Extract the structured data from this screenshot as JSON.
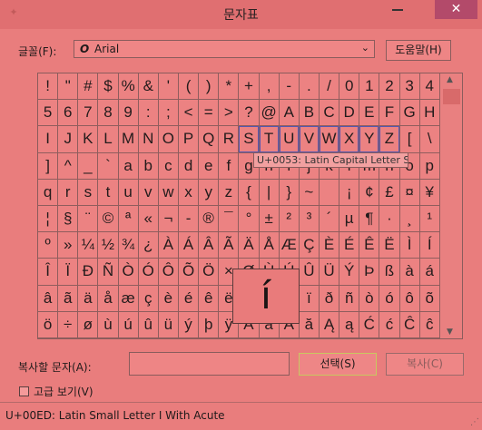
{
  "window": {
    "title": "문자표",
    "close_symbol": "✕",
    "app_icon": "charmap-icon"
  },
  "font": {
    "label": "글꼴(F):",
    "value": "Arial",
    "type_glyph": "O"
  },
  "help_button": "도움말(H)",
  "grid": {
    "rows": [
      [
        "!",
        "\"",
        "#",
        "$",
        "%",
        "&",
        "'",
        "(",
        ")",
        "*",
        "+",
        ",",
        "-",
        ".",
        "/",
        "0",
        "1",
        "2",
        "3",
        "4"
      ],
      [
        "5",
        "6",
        "7",
        "8",
        "9",
        ":",
        ";",
        "<",
        "=",
        ">",
        "?",
        "@",
        "A",
        "B",
        "C",
        "D",
        "E",
        "F",
        "G",
        "H"
      ],
      [
        "I",
        "J",
        "K",
        "L",
        "M",
        "N",
        "O",
        "P",
        "Q",
        "R",
        "S",
        "T",
        "U",
        "V",
        "W",
        "X",
        "Y",
        "Z",
        "[",
        "\\"
      ],
      [
        "]",
        "^",
        "_",
        "`",
        "a",
        "b",
        "c",
        "d",
        "e",
        "f",
        "g",
        "h",
        "i",
        "j",
        "k",
        "l",
        "m",
        "n",
        "o",
        "p"
      ],
      [
        "q",
        "r",
        "s",
        "t",
        "u",
        "v",
        "w",
        "x",
        "y",
        "z",
        "{",
        "|",
        "}",
        "~",
        "",
        "¡",
        "¢",
        "£",
        "¤",
        "¥"
      ],
      [
        "¦",
        "§",
        "¨",
        "©",
        "ª",
        "«",
        "¬",
        "-",
        "®",
        "¯",
        "°",
        "±",
        "²",
        "³",
        "´",
        "µ",
        "¶",
        "·",
        "¸",
        "¹"
      ],
      [
        "º",
        "»",
        "¼",
        "½",
        "¾",
        "¿",
        "À",
        "Á",
        "Â",
        "Ã",
        "Ä",
        "Å",
        "Æ",
        "Ç",
        "È",
        "É",
        "Ê",
        "Ë",
        "Ì",
        "Í"
      ],
      [
        "Î",
        "Ï",
        "Ð",
        "Ñ",
        "Ò",
        "Ó",
        "Ô",
        "Õ",
        "Ö",
        "×",
        "Ø",
        "Ù",
        "Ú",
        "Û",
        "Ü",
        "Ý",
        "Þ",
        "ß",
        "à",
        "á"
      ],
      [
        "â",
        "ã",
        "ä",
        "å",
        "æ",
        "ç",
        "è",
        "é",
        "ê",
        "ë",
        "ì",
        "í",
        "î",
        "ï",
        "ð",
        "ñ",
        "ò",
        "ó",
        "ô",
        "õ"
      ],
      [
        "ö",
        "÷",
        "ø",
        "ù",
        "ú",
        "û",
        "ü",
        "ý",
        "þ",
        "ÿ",
        "Ā",
        "ā",
        "Ă",
        "ă",
        "Ą",
        "ą",
        "Ć",
        "ć",
        "Ĉ",
        "ĉ"
      ]
    ],
    "highlighted_row": 2,
    "highlighted_cols": [
      10,
      11,
      12,
      13,
      14,
      15,
      16,
      17
    ]
  },
  "tooltip": "U+0053: Latin Capital Letter S",
  "magnified_char": "í",
  "copy": {
    "label": "복사할 문자(A):",
    "value": "",
    "select_button": "선택(S)",
    "copy_button": "복사(C)"
  },
  "advanced": {
    "label": "고급 보기(V)",
    "checked": false
  },
  "status": "U+00ED: Latin Small Letter I With Acute",
  "colors": {
    "background": "#e97d7d",
    "highlight_border": "#5557b0"
  }
}
